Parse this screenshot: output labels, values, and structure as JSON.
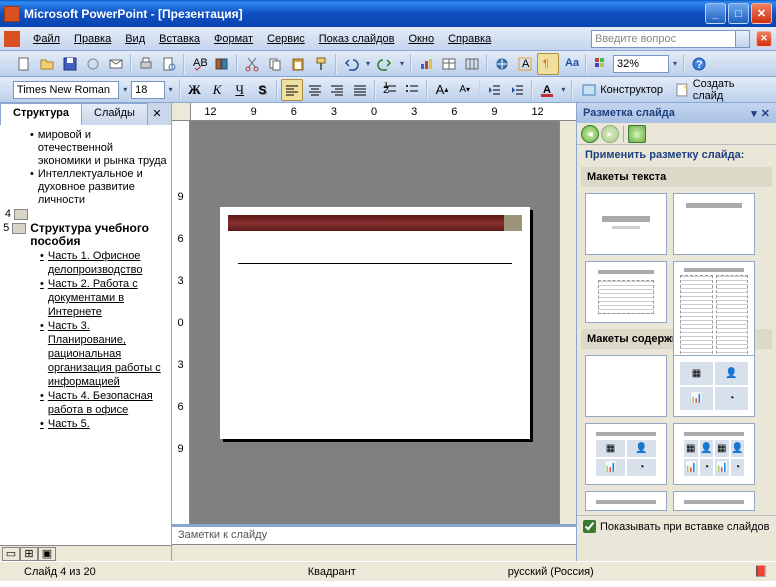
{
  "title": "Microsoft PowerPoint - [Презентация]",
  "menu": [
    "Файл",
    "Правка",
    "Вид",
    "Вставка",
    "Формат",
    "Сервис",
    "Показ слайдов",
    "Окно",
    "Справка"
  ],
  "askHint": "Введите вопрос",
  "zoom": "32%",
  "font": "Times New Roman",
  "fontSize": "18",
  "designer": "Конструктор",
  "newSlide": "Создать слайд",
  "tabs": {
    "outline": "Структура",
    "slides": "Слайды"
  },
  "rulerH": [
    "12",
    "9",
    "6",
    "3",
    "0",
    "3",
    "6",
    "9",
    "12"
  ],
  "rulerV": [
    "9",
    "6",
    "3",
    "0",
    "3",
    "6",
    "9"
  ],
  "outline": {
    "bullets1": [
      "мировой и отечественной экономики и рынка труда",
      "Интеллектуальное и духовное развитие личности"
    ],
    "slide4num": "4",
    "slide5num": "5",
    "slide5title": "Структура учебного пособия",
    "subs": [
      "Часть 1. Офисное делопроизводство",
      "Часть 2. Работа с документами в Интернете",
      "Часть 3. Планирование, рациональная организация работы с информацией",
      "Часть 4. Безопасная работа в офисе",
      "Часть 5."
    ]
  },
  "notesHint": "Заметки к слайду",
  "taskpane": {
    "title": "Разметка слайда",
    "apply": "Применить разметку слайда:",
    "sect1": "Макеты текста",
    "sect2": "Макеты содержимого",
    "showOnInsert": "Показывать при вставке слайдов"
  },
  "status": {
    "slide": "Слайд 4 из 20",
    "center": "Квадрант",
    "lang": "русский (Россия)"
  }
}
